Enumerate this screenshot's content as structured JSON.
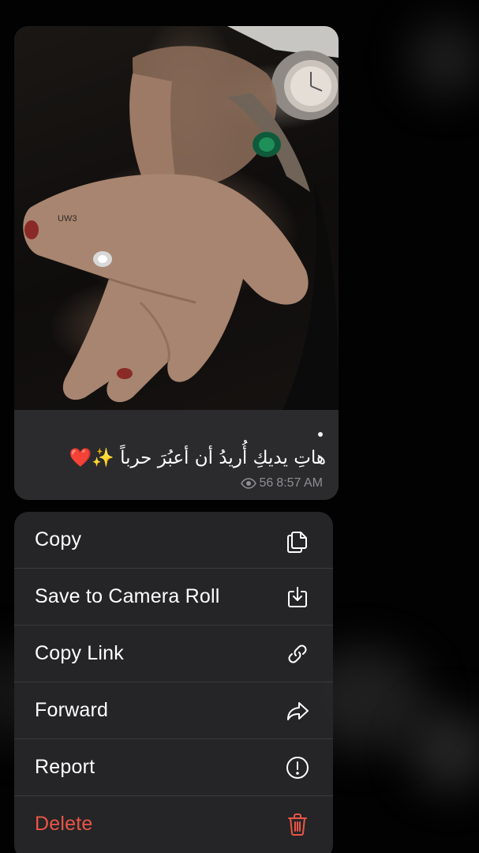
{
  "message": {
    "caption": "هاتِ يديكِ أُريدُ أن أعبُرَ حرباً ✨❤️",
    "views": "56",
    "time": "8:57 AM",
    "view_icon": "eye-icon",
    "image_watermark": "UW3"
  },
  "context_menu": {
    "items": [
      {
        "label": "Copy",
        "icon": "copy-icon"
      },
      {
        "label": "Save to Camera Roll",
        "icon": "save-to-camera-roll-icon"
      },
      {
        "label": "Copy Link",
        "icon": "link-icon"
      },
      {
        "label": "Forward",
        "icon": "forward-arrow-icon"
      },
      {
        "label": "Report",
        "icon": "exclamation-circle-icon"
      },
      {
        "label": "Delete",
        "icon": "trash-icon",
        "destructive": true
      }
    ]
  },
  "colors": {
    "menu_background": "#272729",
    "separator": "#3a3a3c",
    "destructive": "#eb5545",
    "text": "#ffffff",
    "meta_text": "#8e8e93"
  }
}
